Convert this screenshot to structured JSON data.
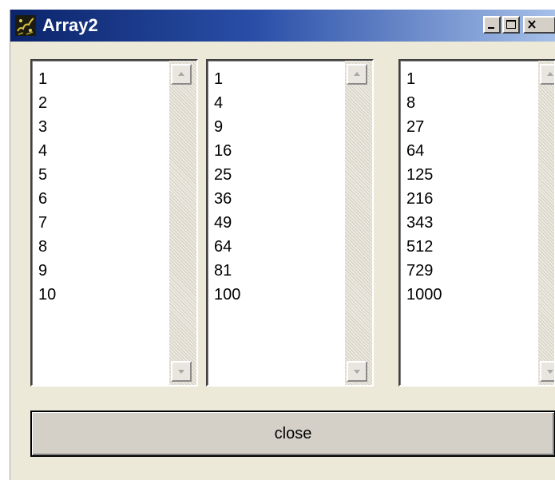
{
  "window": {
    "title": "Array2",
    "icon": "java-app-icon"
  },
  "lists": [
    {
      "items": [
        "1",
        "2",
        "3",
        "4",
        "5",
        "6",
        "7",
        "8",
        "9",
        "10"
      ]
    },
    {
      "items": [
        "1",
        "4",
        "9",
        "16",
        "25",
        "36",
        "49",
        "64",
        "81",
        "100"
      ]
    },
    {
      "items": [
        "1",
        "8",
        "27",
        "64",
        "125",
        "216",
        "343",
        "512",
        "729",
        "1000"
      ]
    }
  ],
  "buttons": {
    "close_label": "close"
  },
  "colors": {
    "title_bar_start": "#0b246a",
    "title_bar_end": "#a6c0e8",
    "window_bg": "#ece9d8"
  }
}
